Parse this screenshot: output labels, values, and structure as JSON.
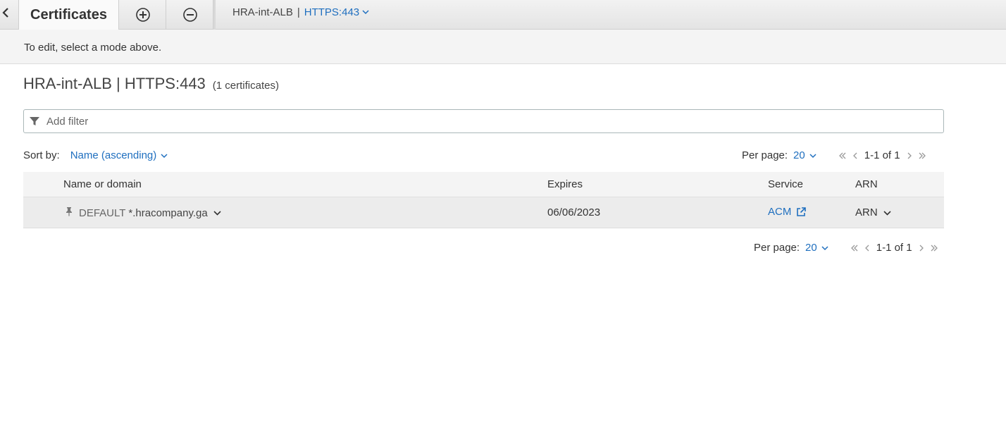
{
  "tabs": {
    "active_label": "Certificates"
  },
  "breadcrumb": {
    "load_balancer": "HRA-int-ALB",
    "separator": "|",
    "listener": "HTTPS:443"
  },
  "info": {
    "message": "To edit, select a mode above."
  },
  "heading": {
    "title": "HRA-int-ALB | HTTPS:443",
    "count": "(1 certificates)"
  },
  "filter": {
    "placeholder": "Add filter"
  },
  "sort": {
    "label": "Sort by:",
    "value": "Name (ascending)"
  },
  "pagination": {
    "per_page_label": "Per page:",
    "per_page_value": "20",
    "range": "1-1 of 1"
  },
  "table": {
    "columns": [
      "Name or domain",
      "Expires",
      "Service",
      "ARN"
    ],
    "rows": [
      {
        "badge": "DEFAULT",
        "domain": "*.hracompany.ga",
        "expires": "06/06/2023",
        "service": "ACM",
        "arn": "ARN"
      }
    ]
  },
  "colors": {
    "link": "#1f6fbf",
    "header_bg": "#f4f4f4",
    "row_bg": "#ececec"
  },
  "icons": [
    "back-icon",
    "plus-circle-icon",
    "minus-circle-icon",
    "chevron-down-icon",
    "filter-icon",
    "pin-icon",
    "external-link-icon",
    "first-page-icon",
    "previous-page-icon",
    "next-page-icon",
    "last-page-icon"
  ]
}
